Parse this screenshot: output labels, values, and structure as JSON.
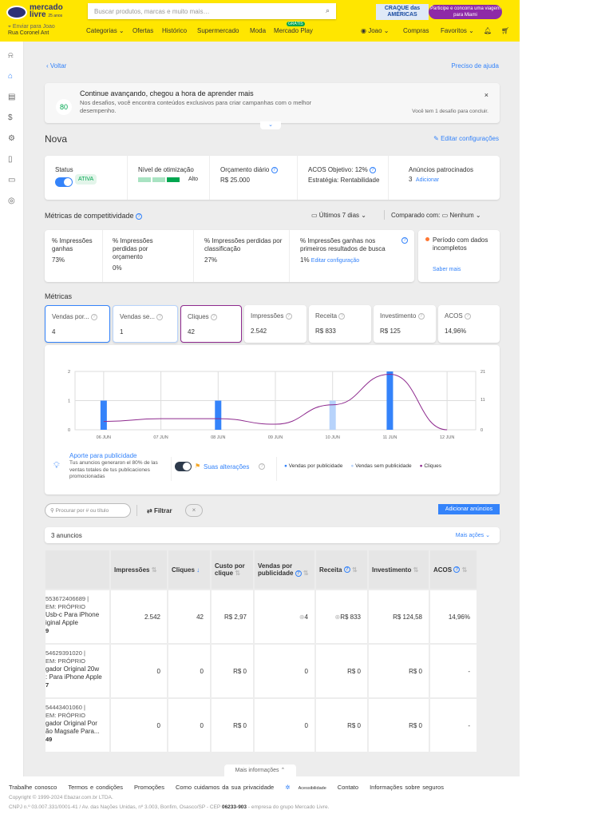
{
  "header": {
    "logo_line1": "mercado",
    "logo_line2": "livre",
    "logo_anniv": "25 anos",
    "search_placeholder": "Buscar produtos, marcas e muito mais…",
    "promo_left": "CRAQUE das AMÉRICAS",
    "promo_right": "Participe e concorra uma viagem para Miami",
    "ship_line1": "Enviar para Joao",
    "ship_line2": "Rua Coronel Ant",
    "nav": [
      "Categorias",
      "Ofertas",
      "Histórico",
      "Supermercado",
      "Moda",
      "Mercado Play"
    ],
    "gratis": "GRÁTIS",
    "user": "Joao",
    "compras": "Compras",
    "favoritos": "Favoritos"
  },
  "top": {
    "back": "Voltar",
    "help": "Preciso de ajuda"
  },
  "banner": {
    "score": "80",
    "title": "Continue avançando, chegou a hora de aprender mais",
    "text": "Nos desafios, você encontra conteúdos exclusivos para criar campanhas com o melhor desempenho.",
    "right": "Você tem 1 desafio para concluir."
  },
  "campaign": {
    "name": "Nova",
    "edit": "Editar configurações",
    "status_label": "Status",
    "status": "ATIVA",
    "opt_label": "Nível de otimização",
    "opt_value": "Alto",
    "budget_label": "Orçamento diário",
    "budget": "R$ 25.000",
    "acos_label": "ACOS Objetivo: 12%",
    "strategy": "Estratégia: Rentabilidade",
    "ads_label": "Anúncios patrocinados",
    "ads_count": "3",
    "ads_add": "Adicionar"
  },
  "competitiveness": {
    "title": "Métricas de competitividade",
    "period": "Últimos 7 dias",
    "compare_label": "Comparado com:",
    "compare_value": "Nenhum",
    "items": [
      {
        "label": "% Impressões ganhas",
        "value": "73%"
      },
      {
        "label": "% Impressões perdidas por orçamento",
        "value": "0%"
      },
      {
        "label": "% Impressões perdidas por classificação",
        "value": "27%"
      },
      {
        "label": "% Impressões ganhas nos primeiros resultados de busca",
        "value": "1%",
        "link": "Editar configuração"
      }
    ],
    "incomplete": "Período com dados incompletos",
    "learn": "Saber mais"
  },
  "metrics": {
    "title": "Métricas",
    "tabs": [
      {
        "label": "Vendas por...",
        "value": "4"
      },
      {
        "label": "Vendas se...",
        "value": "1"
      },
      {
        "label": "Cliques",
        "value": "42"
      },
      {
        "label": "Impressões",
        "value": "2.542"
      },
      {
        "label": "Receita",
        "value": "R$ 833"
      },
      {
        "label": "Investimento",
        "value": "R$ 125"
      },
      {
        "label": "ACOS",
        "value": "14,96%"
      }
    ]
  },
  "chart_data": {
    "type": "bar",
    "categories": [
      "06 JUN",
      "07 JUN",
      "08 JUN",
      "09 JUN",
      "10 JUN",
      "11 JUN",
      "12 JUN"
    ],
    "series": [
      {
        "name": "Vendas por publicidade",
        "values": [
          1,
          0,
          1,
          0,
          0,
          2,
          0
        ],
        "color": "#3483fa"
      },
      {
        "name": "Vendas sem publicidade",
        "values": [
          0,
          0,
          0,
          0,
          1,
          0,
          0
        ],
        "color": "#b7d3fb"
      },
      {
        "name": "Cliques",
        "type": "line",
        "axis": "right",
        "values": [
          3,
          4,
          4,
          2,
          9,
          20,
          0
        ],
        "color": "#8e2a8e"
      }
    ],
    "ylim": [
      0,
      2
    ],
    "yticks": [
      "0",
      "1",
      "2"
    ],
    "y2lim": [
      0,
      21
    ],
    "y2ticks": [
      "0",
      "11",
      "21"
    ]
  },
  "insight": {
    "title": "Aporte para publicidade",
    "text": "Tus anuncios generaron el 80% de las ventas totales de tus publicaciones promocionadas",
    "changes": "Suas alterações"
  },
  "toolbar": {
    "search_placeholder": "Procurar por # ou título",
    "filter": "Filtrar",
    "add": "Adicionar anúncios"
  },
  "table": {
    "count": "3 anuncios",
    "more": "Mais ações",
    "headers": [
      "Impressões",
      "Cliques",
      "Custo por clique",
      "Vendas por publicidade",
      "Receita",
      "Investimento",
      "ACOS"
    ],
    "rows": [
      {
        "id": "553672406689 |",
        "type": "EM: PRÓPRIO",
        "title1": "Usb-c Para iPhone",
        "title2": "iginal Apple",
        "price": "9",
        "cells": [
          "2.542",
          "42",
          "R$ 2,97",
          "4",
          "R$ 833",
          "R$ 124,58",
          "14,96%"
        ]
      },
      {
        "id": "54629391020 |",
        "type": "EM: PRÓPRIO",
        "title1": "gador Original 20w",
        "title2": ": Para iPhone Apple",
        "price": "7",
        "cells": [
          "0",
          "0",
          "R$ 0",
          "0",
          "R$ 0",
          "R$ 0",
          "-"
        ]
      },
      {
        "id": "54443401060 |",
        "type": "EM: PRÓPRIO",
        "title1": "gador Original Por",
        "title2": "ão Magsafe Para...",
        "price": "49",
        "cells": [
          "0",
          "0",
          "R$ 0",
          "0",
          "R$ 0",
          "R$ 0",
          "-"
        ]
      }
    ]
  },
  "footer": {
    "more": "Mais informações",
    "links": [
      "Trabalhe conosco",
      "Termos e condições",
      "Promoções",
      "Como cuidamos da sua privacidade",
      "Acessibilidade",
      "Contato",
      "Informações sobre seguros"
    ],
    "copyright": "Copyright © 1999-2024 Ebazar.com.br LTDA.",
    "address_a": "CNPJ n.º 03.007.331/0001-41 / Av. das Nações Unidas, nº 3.003, Bonfim, Osasco/SP - CEP ",
    "cep": "06233-903",
    "address_b": " - empresa do grupo Mercado Livre."
  }
}
